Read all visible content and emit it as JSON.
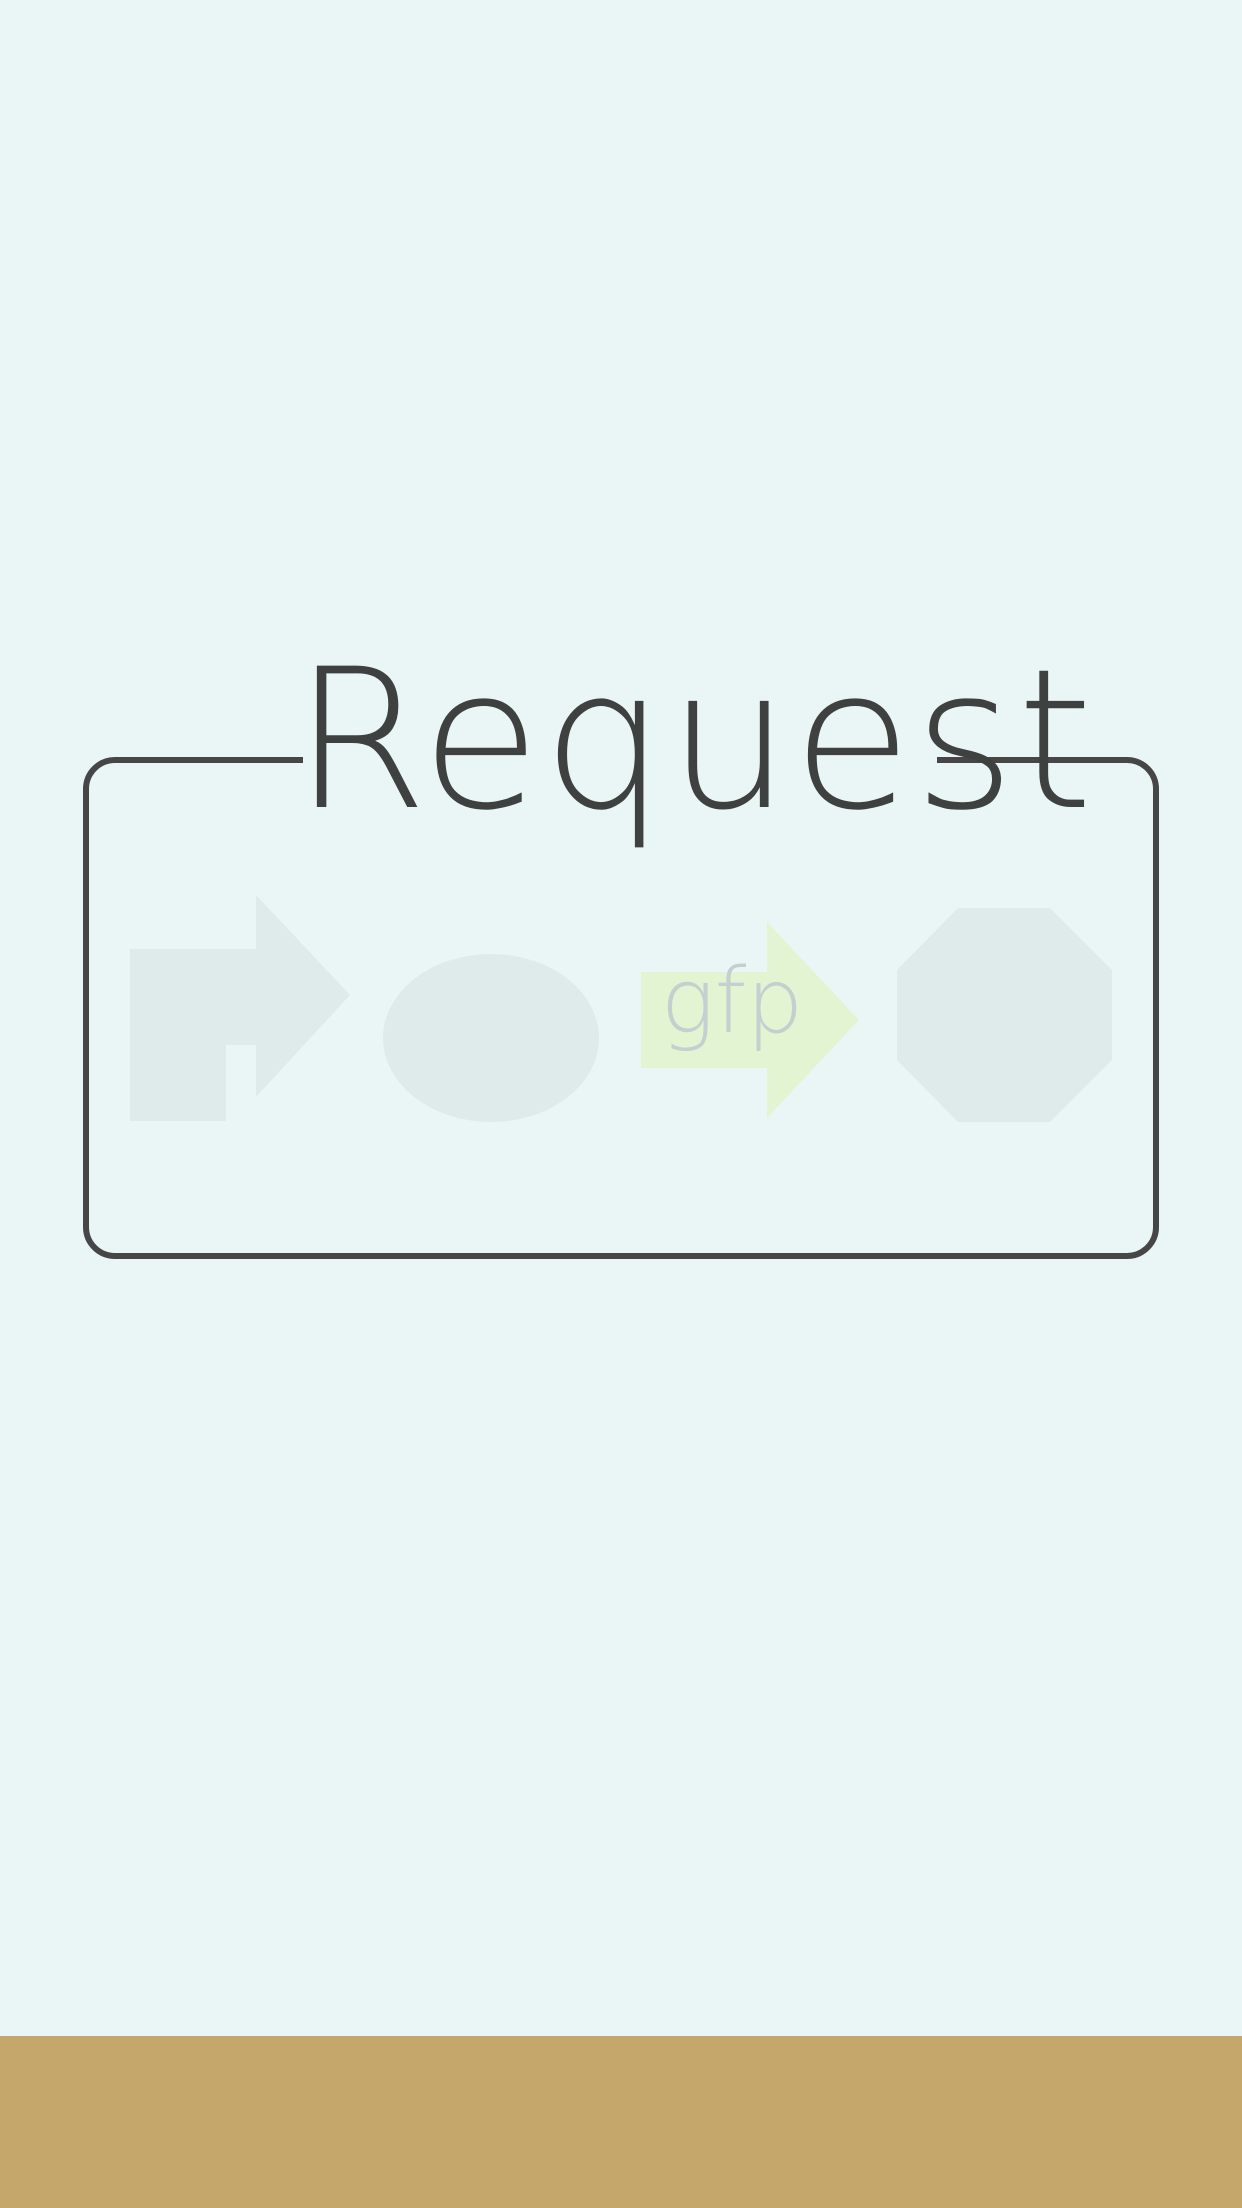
{
  "title": "Request",
  "request_box": {
    "shapes": [
      {
        "kind": "turn-arrow",
        "icon": "turn-arrow-icon",
        "color": "#dfeaea"
      },
      {
        "kind": "ellipse",
        "icon": "ellipse-icon",
        "color": "#dfeaea"
      },
      {
        "kind": "right-arrow",
        "icon": "right-arrow-icon",
        "color": "#e2f4d2",
        "label": "gfp"
      },
      {
        "kind": "octagon",
        "icon": "octagon-icon",
        "color": "#dfeaea"
      }
    ]
  },
  "colors": {
    "background": "#eaf6f5",
    "frame": "#464646",
    "title_text": "#3f4141",
    "bottom_bar": "#c6a76b"
  }
}
